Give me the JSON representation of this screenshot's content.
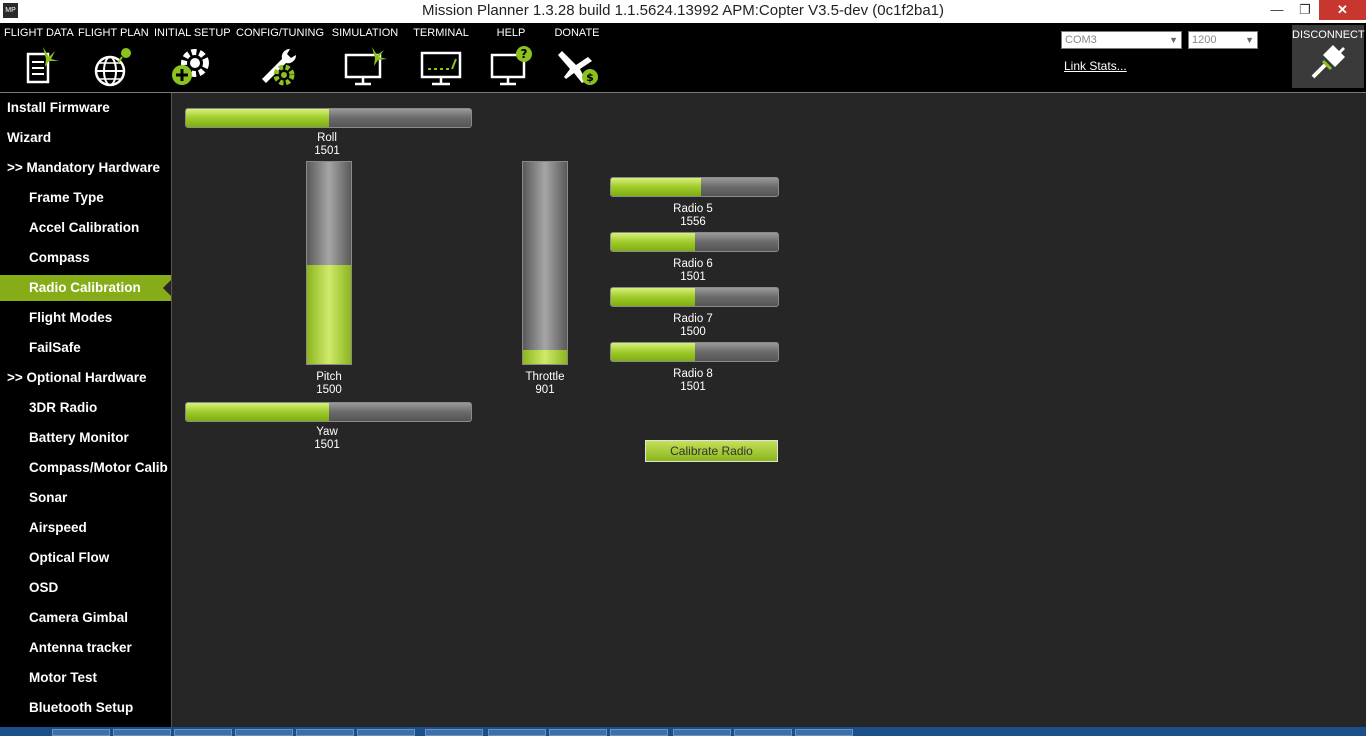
{
  "window": {
    "app_icon": "MP",
    "title": "Mission Planner 1.3.28 build 1.1.5624.13992 APM:Copter V3.5-dev (0c1f2ba1)",
    "minimize": "—",
    "maximize": "❐",
    "close": "✕"
  },
  "toolbar": {
    "items": [
      {
        "label": "FLIGHT DATA",
        "icon": "flight-data-icon"
      },
      {
        "label": "FLIGHT PLAN",
        "icon": "flight-plan-icon"
      },
      {
        "label": "INITIAL SETUP",
        "icon": "initial-setup-icon"
      },
      {
        "label": "CONFIG/TUNING",
        "icon": "config-tuning-icon"
      },
      {
        "label": "SIMULATION",
        "icon": "simulation-icon"
      },
      {
        "label": "TERMINAL",
        "icon": "terminal-icon"
      },
      {
        "label": "HELP",
        "icon": "help-icon"
      },
      {
        "label": "DONATE",
        "icon": "donate-icon"
      }
    ],
    "port": "COM3",
    "baud": "1200",
    "link_stats": "Link Stats...",
    "disconnect": "DISCONNECT"
  },
  "sidebar": {
    "items": [
      {
        "label": "Install Firmware",
        "level": 0,
        "active": false
      },
      {
        "label": "Wizard",
        "level": 0,
        "active": false
      },
      {
        "label": ">> Mandatory Hardware",
        "level": 0,
        "active": false
      },
      {
        "label": "Frame Type",
        "level": 1,
        "active": false
      },
      {
        "label": "Accel Calibration",
        "level": 1,
        "active": false
      },
      {
        "label": "Compass",
        "level": 1,
        "active": false
      },
      {
        "label": "Radio Calibration",
        "level": 1,
        "active": true
      },
      {
        "label": "Flight Modes",
        "level": 1,
        "active": false
      },
      {
        "label": "FailSafe",
        "level": 1,
        "active": false
      },
      {
        "label": ">> Optional Hardware",
        "level": 0,
        "active": false
      },
      {
        "label": "3DR Radio",
        "level": 1,
        "active": false
      },
      {
        "label": "Battery Monitor",
        "level": 1,
        "active": false
      },
      {
        "label": "Compass/Motor Calib",
        "level": 1,
        "active": false
      },
      {
        "label": "Sonar",
        "level": 1,
        "active": false
      },
      {
        "label": "Airspeed",
        "level": 1,
        "active": false
      },
      {
        "label": "Optical Flow",
        "level": 1,
        "active": false
      },
      {
        "label": "OSD",
        "level": 1,
        "active": false
      },
      {
        "label": "Camera Gimbal",
        "level": 1,
        "active": false
      },
      {
        "label": "Antenna tracker",
        "level": 1,
        "active": false
      },
      {
        "label": "Motor Test",
        "level": 1,
        "active": false
      },
      {
        "label": "Bluetooth Setup",
        "level": 1,
        "active": false
      }
    ]
  },
  "radio": {
    "range": [
      900,
      2100
    ],
    "channels": {
      "roll": {
        "label": "Roll",
        "value": "1501",
        "fill": 0.5
      },
      "pitch": {
        "label": "Pitch",
        "value": "1500",
        "fill": 0.49
      },
      "throttle": {
        "label": "Throttle",
        "value": "901",
        "fill": 0.07
      },
      "yaw": {
        "label": "Yaw",
        "value": "1501",
        "fill": 0.5
      },
      "radio5": {
        "label": "Radio 5",
        "value": "1556",
        "fill": 0.54
      },
      "radio6": {
        "label": "Radio 6",
        "value": "1501",
        "fill": 0.5
      },
      "radio7": {
        "label": "Radio 7",
        "value": "1500",
        "fill": 0.5
      },
      "radio8": {
        "label": "Radio 8",
        "value": "1501",
        "fill": 0.5
      }
    },
    "calibrate_button": "Calibrate Radio"
  },
  "colors": {
    "accent": "#86ad17",
    "bar_fill": "#9ecb2a",
    "background": "#262626",
    "sidebar": "#000000"
  }
}
